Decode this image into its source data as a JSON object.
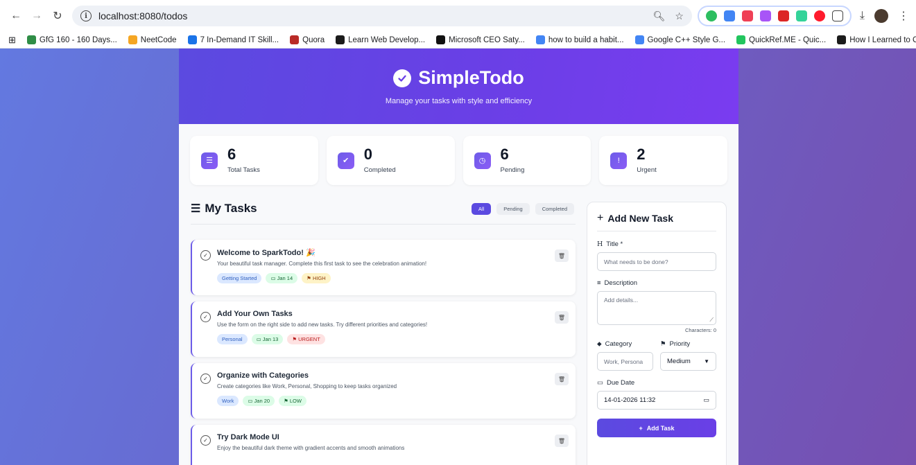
{
  "browser": {
    "url": "localhost:8080/todos",
    "bookmarks": [
      {
        "label": "GfG 160 - 160 Days...",
        "color": "#2f8d46"
      },
      {
        "label": "NeetCode",
        "color": "#f5a623"
      },
      {
        "label": "7 In-Demand IT Skill...",
        "color": "#1a73e8"
      },
      {
        "label": "Quora",
        "color": "#b92b27"
      },
      {
        "label": "Learn Web Develop...",
        "color": "#1b1b1b"
      },
      {
        "label": "Microsoft CEO Saty...",
        "color": "#111111"
      },
      {
        "label": "how to build a habit...",
        "color": "#4285f4"
      },
      {
        "label": "Google C++ Style G...",
        "color": "#4285f4"
      },
      {
        "label": "QuickRef.ME - Quic...",
        "color": "#22c55e"
      },
      {
        "label": "How I Learned to C...",
        "color": "#1b1b1b"
      }
    ],
    "more": "»"
  },
  "header": {
    "title": "SimpleTodo",
    "tagline": "Manage your tasks with style and efficiency"
  },
  "stats": [
    {
      "value": "6",
      "label": "Total Tasks",
      "icon": "list-check-icon",
      "glyph": "☰"
    },
    {
      "value": "0",
      "label": "Completed",
      "icon": "check-circle-icon",
      "glyph": "✔"
    },
    {
      "value": "6",
      "label": "Pending",
      "icon": "clock-icon",
      "glyph": "◷"
    },
    {
      "value": "2",
      "label": "Urgent",
      "icon": "alert-icon",
      "glyph": "!"
    }
  ],
  "tasks_panel": {
    "title": "My Tasks",
    "filters": [
      "All",
      "Pending",
      "Completed"
    ]
  },
  "tasks": [
    {
      "title": "Welcome to SparkTodo! 🎉",
      "desc": "Your beautiful task manager. Complete this first task to see the celebration animation!",
      "category": "Getting Started",
      "date": "Jan 14",
      "priority": "HIGH",
      "pclass": "high"
    },
    {
      "title": "Add Your Own Tasks",
      "desc": "Use the form on the right side to add new tasks. Try different priorities and categories!",
      "category": "Personal",
      "date": "Jan 13",
      "priority": "URGENT",
      "pclass": "urgent"
    },
    {
      "title": "Organize with Categories",
      "desc": "Create categories like Work, Personal, Shopping to keep tasks organized",
      "category": "Work",
      "date": "Jan 20",
      "priority": "LOW",
      "pclass": "low"
    },
    {
      "title": "Try Dark Mode UI",
      "desc": "Enjoy the beautiful dark theme with gradient accents and smooth animations",
      "category": "",
      "date": "",
      "priority": "",
      "pclass": "low"
    }
  ],
  "form": {
    "title": "Add New Task",
    "title_label": "Title *",
    "title_placeholder": "What needs to be done?",
    "desc_label": "Description",
    "desc_placeholder": "Add details...",
    "chars": "Characters: 0",
    "category_label": "Category",
    "category_placeholder": "Work, Persona",
    "priority_label": "Priority",
    "priority_value": "Medium",
    "due_label": "Due Date",
    "due_value": "14-01-2026 11:32",
    "submit": "Add Task"
  }
}
